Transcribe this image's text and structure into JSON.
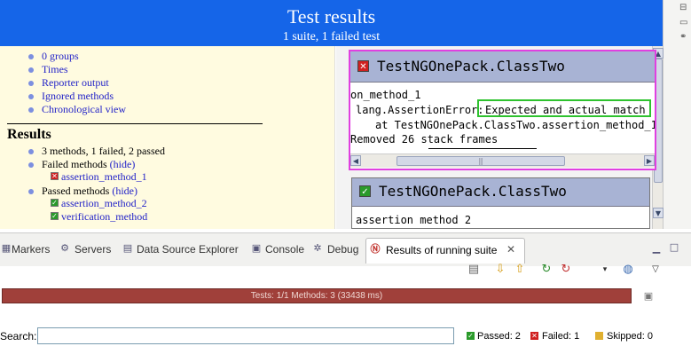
{
  "header": {
    "title": "Test results",
    "subtitle": "1 suite, 1 failed test"
  },
  "nav": {
    "items": [
      "0 groups",
      "Times",
      "Reporter output",
      "Ignored methods",
      "Chronological view"
    ]
  },
  "results": {
    "heading": "Results",
    "summary": "3 methods, 1 failed, 2 passed",
    "failed_label": "Failed methods",
    "passed_label": "Passed methods",
    "hide_label": "(hide)",
    "failed_methods": [
      "assertion_method_1"
    ],
    "passed_methods": [
      "assertion_method_2",
      "verification_method"
    ]
  },
  "card1": {
    "title": "TestNGOnePack.ClassTwo",
    "line1": "on_method_1",
    "line2_prefix": "lang.AssertionError:",
    "line2_highlight": "Expected and actual match",
    "line3": "at TestNGOnePack.ClassTwo.assertion_method_1",
    "line4": "Removed 26 stack frames",
    "status": "failed"
  },
  "card2": {
    "title": "TestNGOnePack.ClassTwo",
    "line1": "assertion method 2",
    "status": "passed"
  },
  "tabs": [
    {
      "label": "Markers",
      "icon": "markers-icon"
    },
    {
      "label": "Servers",
      "icon": "servers-icon"
    },
    {
      "label": "Data Source Explorer",
      "icon": "data-source-icon"
    },
    {
      "label": "Console",
      "icon": "console-icon"
    },
    {
      "label": "Debug",
      "icon": "debug-icon"
    },
    {
      "label": "Results of running suite",
      "icon": "testng-icon",
      "active": true
    }
  ],
  "progress": {
    "text": "Tests: 1/1  Methods: 3 (33438 ms)",
    "color": "#a0403a"
  },
  "search": {
    "label": "Search:",
    "value": ""
  },
  "stats": {
    "passed": "Passed: 2",
    "failed": "Failed: 1",
    "skipped": "Skipped: 0"
  },
  "colors": {
    "header": "#1565e8",
    "nav_bg": "#fffbe0",
    "card_header": "#a8b3d4",
    "highlight_failed": "#e040e0",
    "highlight_message": "#2ec22e"
  }
}
